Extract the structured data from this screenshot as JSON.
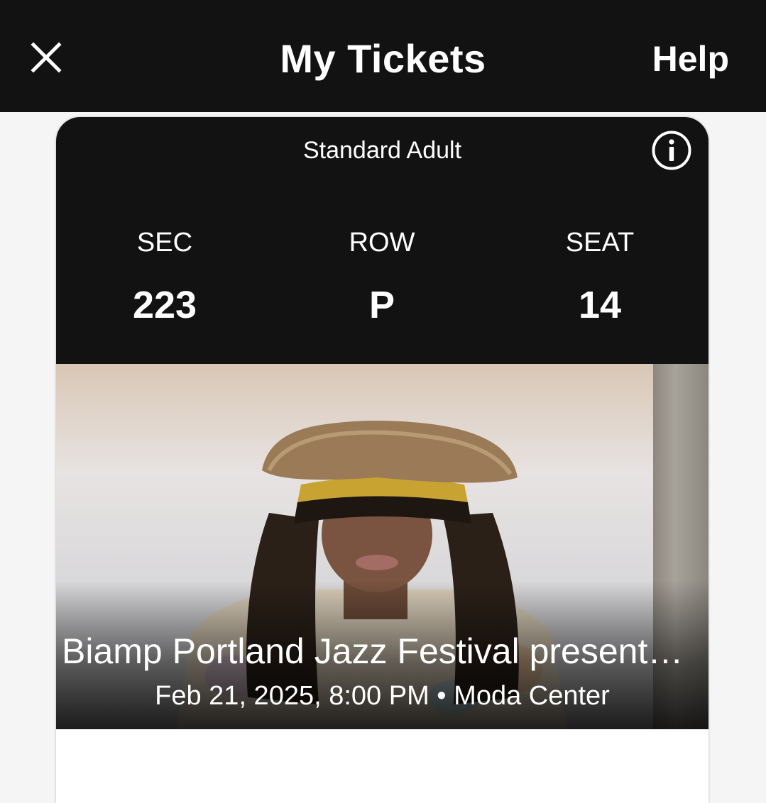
{
  "app_bar": {
    "title": "My Tickets",
    "help_label": "Help",
    "close_icon": "close-icon"
  },
  "ticket": {
    "type": "Standard Adult",
    "info_icon": "info-icon",
    "section_label": "SEC",
    "section_value": "223",
    "row_label": "ROW",
    "row_value": "P",
    "seat_label": "SEAT",
    "seat_value": "14"
  },
  "event": {
    "title": "Biamp Portland Jazz Festival present…",
    "datetime": "Feb 21, 2025, 8:00 PM",
    "separator": "•",
    "venue": "Moda Center"
  },
  "colors": {
    "header_background": "#121212",
    "page_background": "#f5f5f5",
    "text_primary": "#ffffff"
  }
}
